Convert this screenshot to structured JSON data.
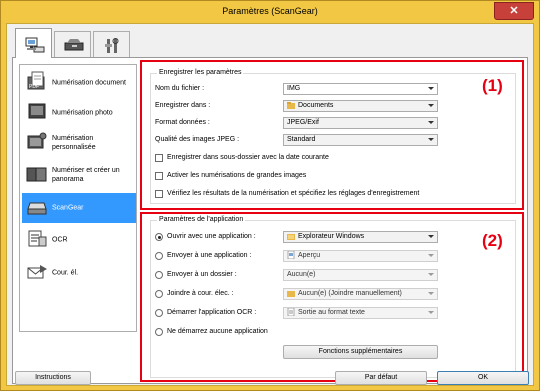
{
  "window": {
    "title": "Paramètres (ScanGear)"
  },
  "tabs": [
    {
      "name": "scan-tab",
      "icon": "scanner-computer-icon"
    },
    {
      "name": "scanner-tab",
      "icon": "scanner-icon"
    },
    {
      "name": "general-tab",
      "icon": "tools-icon"
    }
  ],
  "nav": {
    "items": [
      {
        "label": "Numérisation document",
        "icon": "document-scan-icon"
      },
      {
        "label": "Numérisation photo",
        "icon": "photo-scan-icon"
      },
      {
        "label": "Numérisation personnalisée",
        "icon": "custom-scan-icon"
      },
      {
        "label": "Numériser et créer un panorama",
        "icon": "panorama-icon"
      },
      {
        "label": "ScanGear",
        "icon": "scangear-icon",
        "selected": true
      },
      {
        "label": "OCR",
        "icon": "ocr-icon"
      },
      {
        "label": "Cour. él.",
        "icon": "email-icon"
      }
    ]
  },
  "save_settings": {
    "title": "Enregistrer les paramètres",
    "filename_label": "Nom du fichier :",
    "filename_value": "IMG",
    "save_in_label": "Enregistrer dans :",
    "save_in_value": "Documents",
    "format_label": "Format données :",
    "format_value": "JPEG/Exif",
    "quality_label": "Qualité des images JPEG :",
    "quality_value": "Standard",
    "check_subfolder": "Enregistrer dans sous-dossier avec la date courante",
    "check_large": "Activer les numérisations de grandes images",
    "check_verify": "Vérifiez les résultats de la numérisation et spécifiez les réglages d'enregistrement"
  },
  "app_settings": {
    "title": "Paramètres de l'application",
    "open_with_label": "Ouvrir avec une application :",
    "open_with_value": "Explorateur Windows",
    "send_app_label": "Envoyer à une application :",
    "send_app_value": "Aperçu",
    "send_folder_label": "Envoyer à un dossier :",
    "send_folder_value": "Aucun(e)",
    "attach_mail_label": "Joindre à cour. élec. :",
    "attach_mail_value": "Aucun(e) (Joindre manuellement)",
    "ocr_label": "Démarrer l'application OCR :",
    "ocr_value": "Sortie au format texte",
    "no_app_label": "Ne démarrez aucune application",
    "more_button": "Fonctions supplémentaires"
  },
  "annotations": {
    "one": "(1)",
    "two": "(2)"
  },
  "footer": {
    "instructions": "Instructions",
    "defaults": "Par défaut",
    "ok": "OK"
  }
}
